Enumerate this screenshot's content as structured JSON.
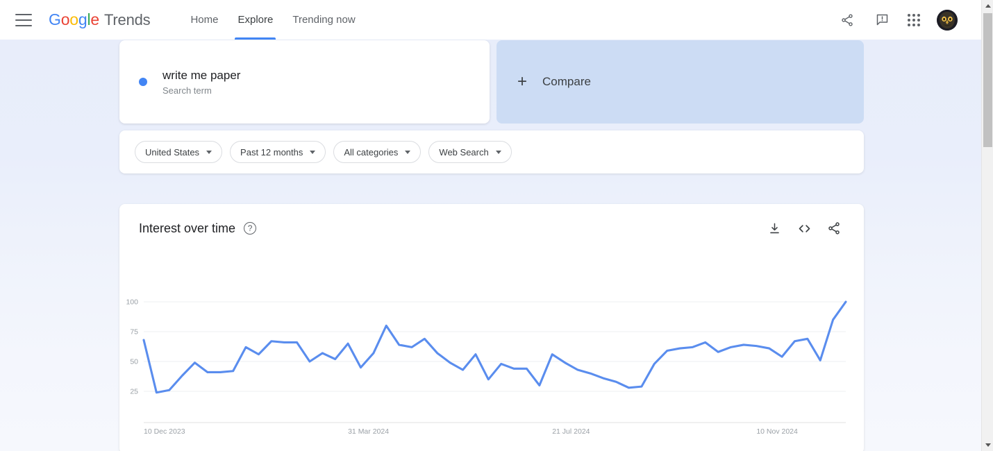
{
  "header": {
    "menu_icon": "hamburger-menu-icon",
    "brand": {
      "google": "Google",
      "product": "Trends"
    },
    "nav": [
      {
        "label": "Home",
        "active": false
      },
      {
        "label": "Explore",
        "active": true
      },
      {
        "label": "Trending now",
        "active": false
      }
    ],
    "icons": [
      {
        "name": "share-icon"
      },
      {
        "name": "feedback-icon"
      },
      {
        "name": "google-apps-icon"
      },
      {
        "name": "account-avatar-owl"
      }
    ]
  },
  "search_term": {
    "title": "write me paper",
    "subtitle": "Search term",
    "dot_color": "#4285F4"
  },
  "compare": {
    "plus": "+",
    "label": "Compare"
  },
  "filters": [
    {
      "label": "United States"
    },
    {
      "label": "Past 12 months"
    },
    {
      "label": "All categories"
    },
    {
      "label": "Web Search"
    }
  ],
  "chart_card": {
    "title": "Interest over time",
    "help": "?",
    "tools": [
      {
        "name": "download-icon"
      },
      {
        "name": "embed-code-icon"
      },
      {
        "name": "share-icon"
      }
    ]
  },
  "chart_data": {
    "type": "line",
    "title": "Interest over time",
    "xlabel": "",
    "ylabel": "",
    "ylim": [
      0,
      100
    ],
    "yticks": [
      25,
      50,
      75,
      100
    ],
    "grid": true,
    "legend": false,
    "line_color": "#5A8DEE",
    "xtick_labels": [
      "10 Dec 2023",
      "31 Mar 2024",
      "21 Jul 2024",
      "10 Nov 2024"
    ],
    "xtick_indices": [
      0,
      16,
      32,
      48
    ],
    "series": [
      {
        "name": "write me paper",
        "values": [
          68,
          24,
          26,
          38,
          49,
          41,
          41,
          42,
          62,
          56,
          67,
          66,
          66,
          50,
          57,
          52,
          65,
          45,
          57,
          80,
          64,
          62,
          69,
          57,
          49,
          43,
          56,
          35,
          48,
          44,
          44,
          30,
          56,
          49,
          43,
          40,
          36,
          33,
          28,
          29,
          48,
          59,
          61,
          62,
          66,
          58,
          62,
          64,
          63,
          61,
          54,
          67,
          69,
          51,
          85,
          100
        ]
      }
    ]
  },
  "scrollbar": {
    "up_arrow": "scroll-up-arrow",
    "down_arrow": "scroll-down-arrow"
  }
}
